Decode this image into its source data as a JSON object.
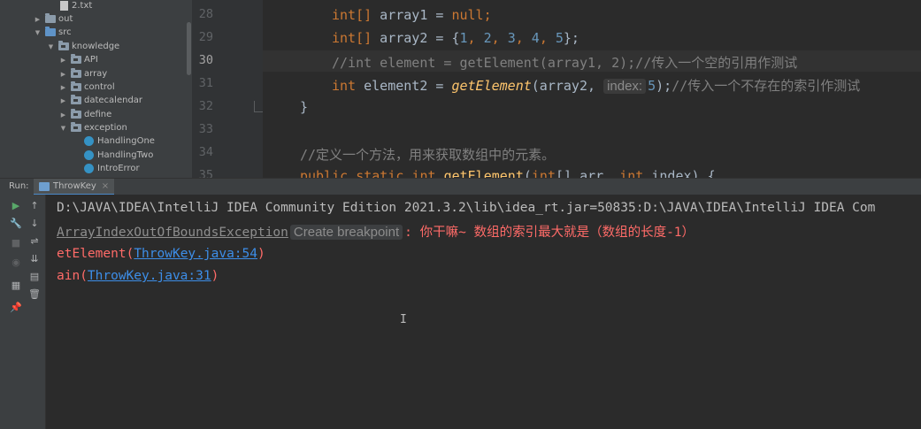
{
  "project_tree": {
    "items": [
      {
        "label": "2.txt",
        "kind": "file",
        "depth": 4,
        "arrow": ""
      },
      {
        "label": "out",
        "kind": "folder",
        "depth": 2,
        "arrow": "▶"
      },
      {
        "label": "src",
        "kind": "src",
        "depth": 2,
        "arrow": "▼"
      },
      {
        "label": "knowledge",
        "kind": "package",
        "depth": 3,
        "arrow": "▼"
      },
      {
        "label": "API",
        "kind": "package",
        "depth": 4,
        "arrow": "▶"
      },
      {
        "label": "array",
        "kind": "package",
        "depth": 4,
        "arrow": "▶"
      },
      {
        "label": "control",
        "kind": "package",
        "depth": 4,
        "arrow": "▶"
      },
      {
        "label": "datecalendar",
        "kind": "package",
        "depth": 4,
        "arrow": "▶"
      },
      {
        "label": "define",
        "kind": "package",
        "depth": 4,
        "arrow": "▶"
      },
      {
        "label": "exception",
        "kind": "package",
        "depth": 4,
        "arrow": "▼"
      },
      {
        "label": "HandlingOne",
        "kind": "class",
        "depth": 5,
        "arrow": ""
      },
      {
        "label": "HandlingTwo",
        "kind": "class",
        "depth": 5,
        "arrow": ""
      },
      {
        "label": "IntroError",
        "kind": "class",
        "depth": 5,
        "arrow": ""
      }
    ]
  },
  "editor": {
    "line_numbers": [
      "28",
      "29",
      "30",
      "31",
      "32",
      "33",
      "34",
      "35"
    ],
    "current_line": "30",
    "lines": {
      "l28": {
        "type": "int[]",
        "rest": " array1 = ",
        "null": "null",
        "end": ";"
      },
      "l29": {
        "type": "int[]",
        "rest": " array2 = {",
        "n1": "1",
        "n2": "2",
        "n3": "3",
        "n4": "4",
        "n5": "5",
        "sep": ", ",
        "end": "};"
      },
      "l30": {
        "comment": "//int element = getElement(array1, 2);//传入一个空的引用作测试"
      },
      "l31": {
        "type": "int",
        "rest": " element2 = ",
        "method": "getElement",
        "args": "(array2, ",
        "hint": "index:",
        "num": "5",
        "end": ");",
        "comment": "//传入一个不存在的索引作测试"
      },
      "l32": {
        "text": "}"
      },
      "l34": {
        "comment": "//定义一个方法，用来获取数组中的元素。"
      },
      "l35": {
        "kw1": "public",
        "kw2": "static",
        "kw3": "int",
        "method": "getElement",
        "p1": "(",
        "t1": "int",
        "p2": "[] arr, ",
        "t2": "int",
        "p3": " index) {"
      }
    }
  },
  "run_panel": {
    "label": "Run:",
    "tab_label": "ThrowKey",
    "tab_close": "×"
  },
  "console": {
    "line1": "D:\\JAVA\\IDEA\\IntelliJ IDEA Community Edition 2021.3.2\\lib\\idea_rt.jar=50835:D:\\JAVA\\IDEA\\IntelliJ IDEA Com",
    "line2": {
      "exception": "ArrayIndexOutOfBoundsException",
      "create_breakpoint": "Create breakpoint",
      "message": ": 你干嘛~ 数组的索引最大就是（数组的长度-1）"
    },
    "line3": {
      "prefix": "etElement(",
      "link": "ThrowKey.java:54",
      "suffix": ")"
    },
    "line4": {
      "prefix": "ain(",
      "link": "ThrowKey.java:31",
      "suffix": ")"
    },
    "cursor": "I"
  },
  "colors": {
    "keyword": "#cc7832",
    "number": "#6897bb",
    "comment": "#808080",
    "method": "#ffc66d",
    "error": "#ff6b68",
    "link": "#3d8ee8"
  }
}
